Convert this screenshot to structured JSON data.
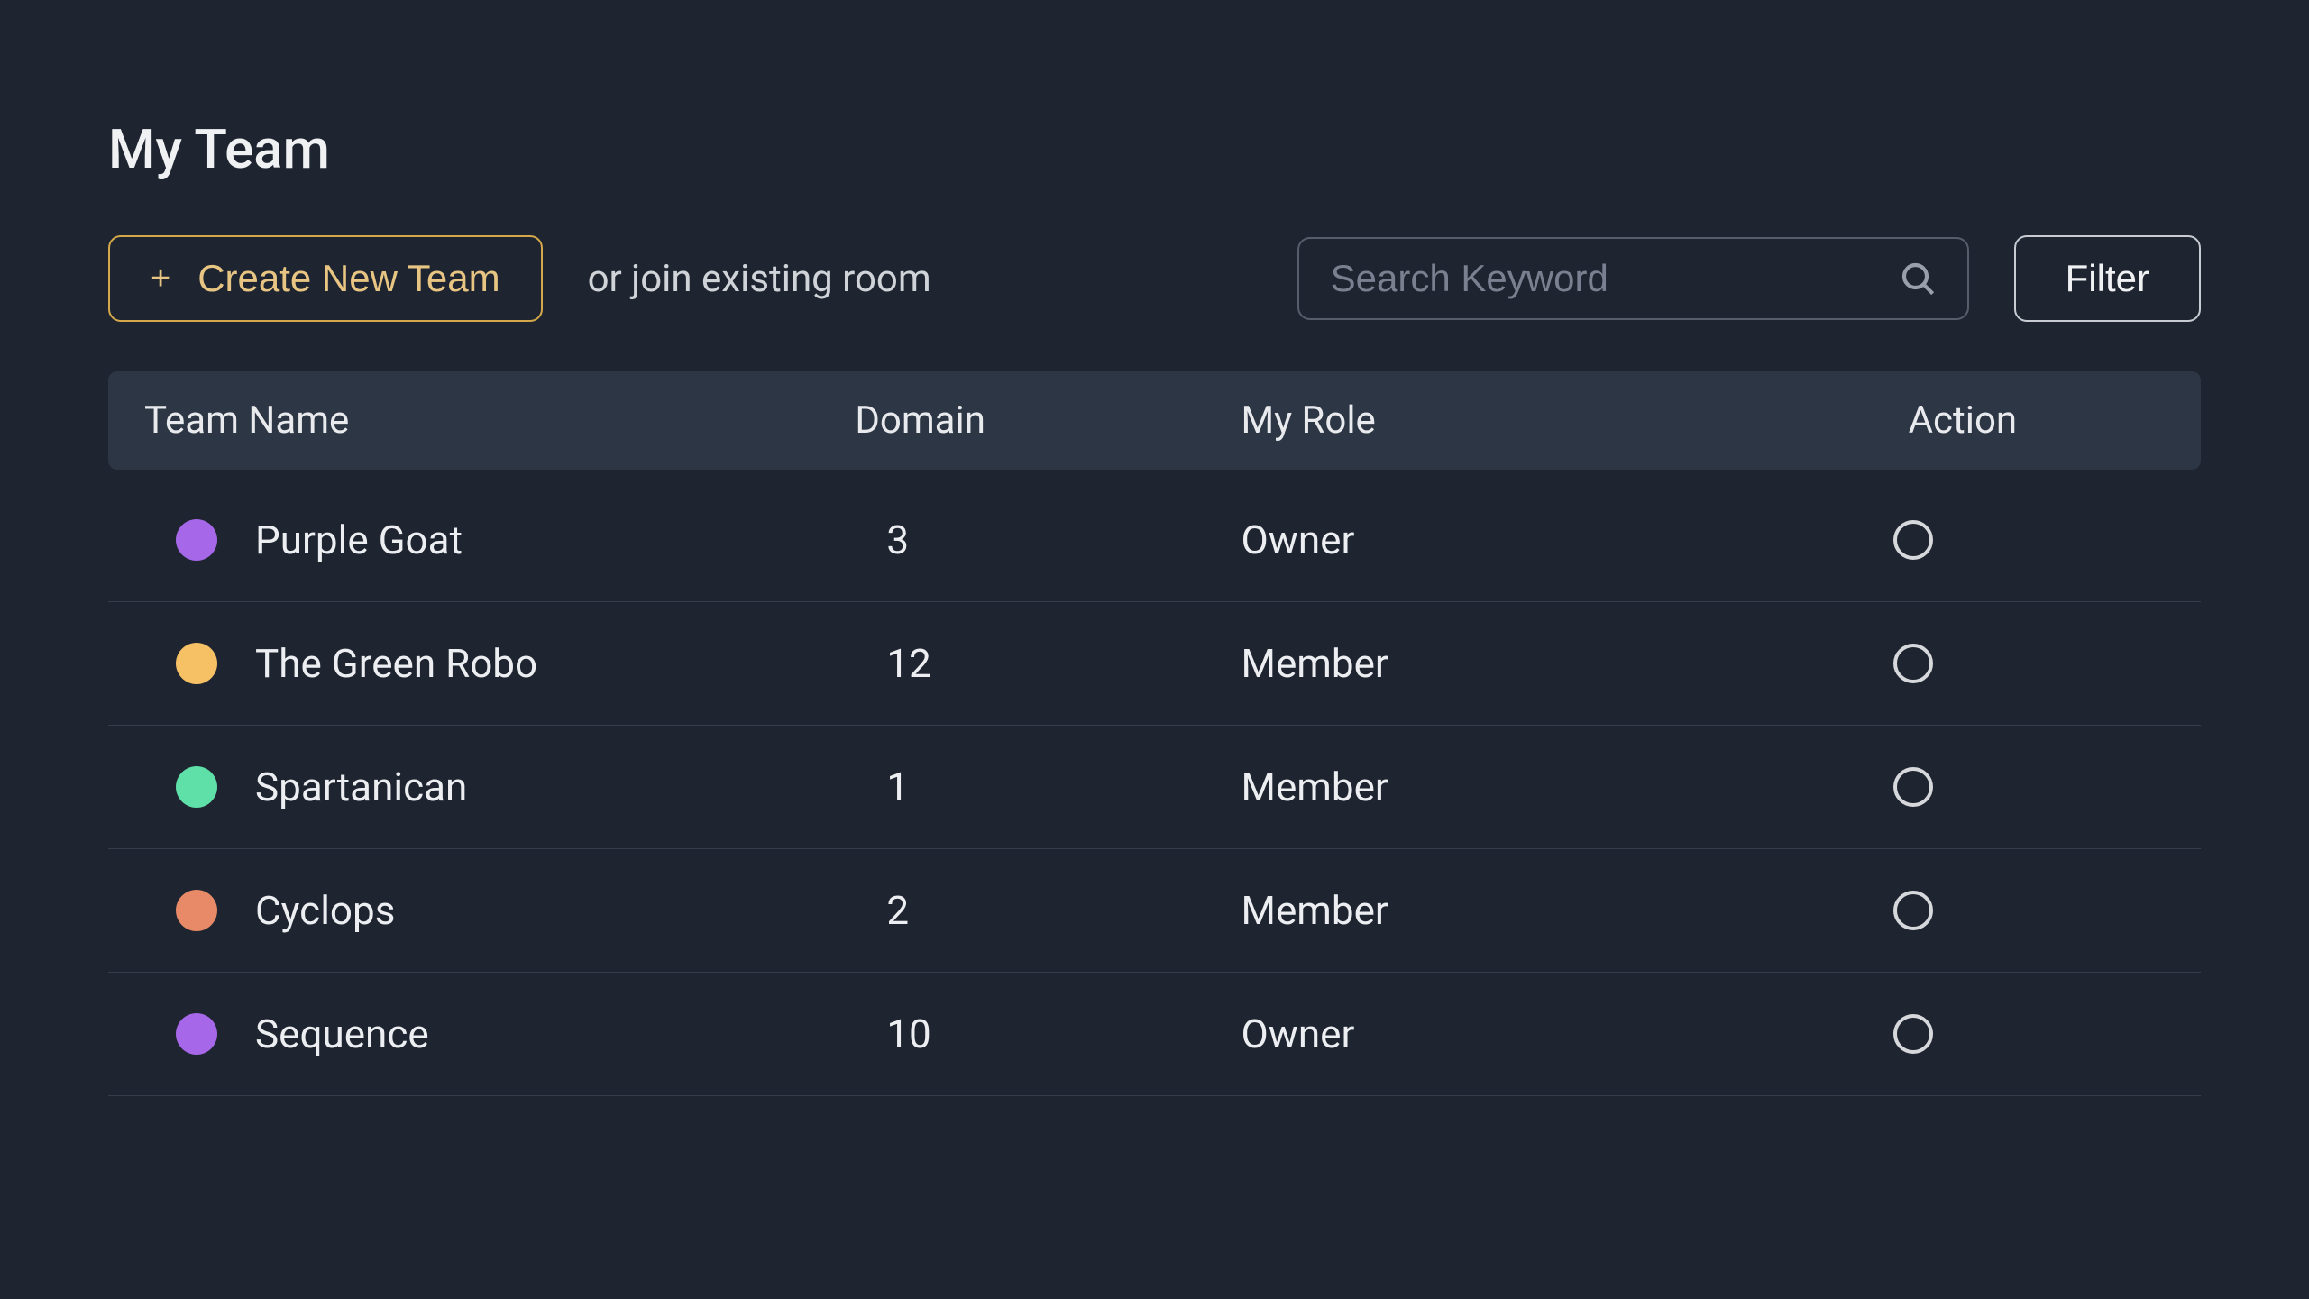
{
  "page": {
    "title": "My Team"
  },
  "controls": {
    "create_button_label": "Create New Team",
    "join_text": "or join existing room",
    "search_placeholder": "Search Keyword",
    "filter_button_label": "Filter"
  },
  "table": {
    "headers": {
      "team_name": "Team Name",
      "domain": "Domain",
      "role": "My Role",
      "action": "Action"
    },
    "rows": [
      {
        "name": "Purple Goat",
        "domain": "3",
        "role": "Owner",
        "dot_color": "#a667e8"
      },
      {
        "name": "The Green Robo",
        "domain": "12",
        "role": "Member",
        "dot_color": "#f5c164"
      },
      {
        "name": "Spartanican",
        "domain": "1",
        "role": "Member",
        "dot_color": "#5fe0a8"
      },
      {
        "name": "Cyclops",
        "domain": "2",
        "role": "Member",
        "dot_color": "#e88a67"
      },
      {
        "name": "Sequence",
        "domain": "10",
        "role": "Owner",
        "dot_color": "#a667e8"
      }
    ]
  }
}
